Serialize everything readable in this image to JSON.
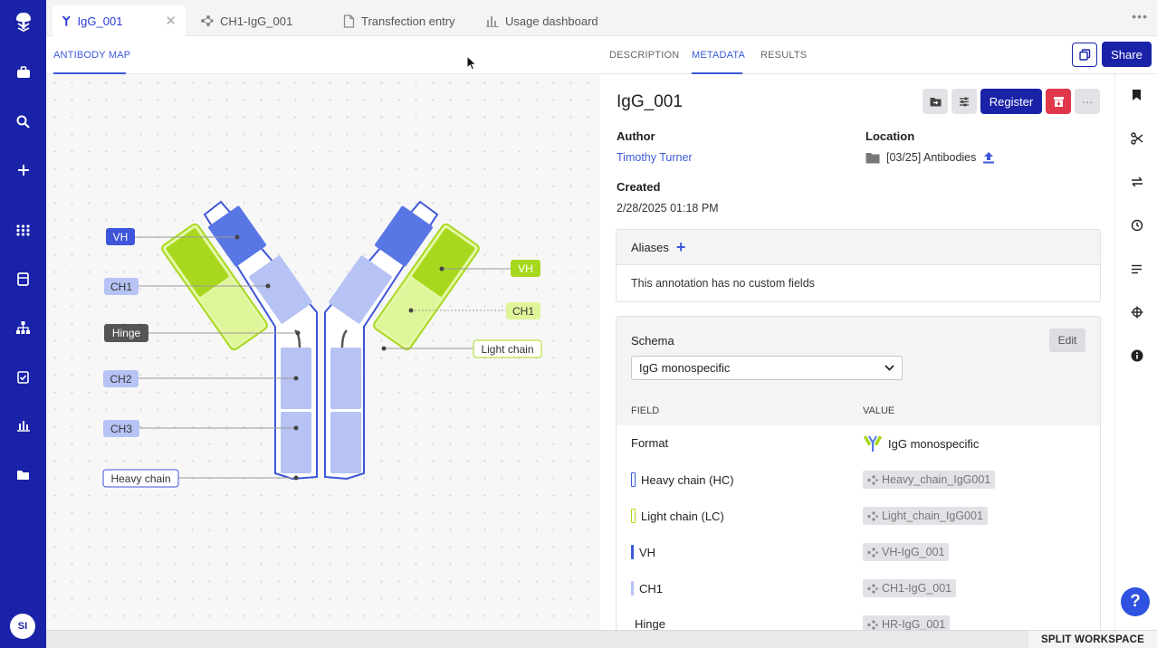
{
  "tabs": [
    {
      "label": "IgG_001",
      "icon": "antibody-icon",
      "active": true
    },
    {
      "label": "CH1-IgG_001",
      "icon": "molecule-icon"
    },
    {
      "label": "Transfection entry",
      "icon": "document-icon"
    },
    {
      "label": "Usage dashboard",
      "icon": "bar-chart-icon"
    }
  ],
  "tab_close": "✕",
  "tab_more": "•••",
  "map": {
    "subtab": "ANTIBODY MAP",
    "labels": {
      "vh_left": "VH",
      "ch1_left": "CH1",
      "hinge": "Hinge",
      "ch2": "CH2",
      "ch3": "CH3",
      "heavy_chain": "Heavy chain",
      "vh_right": "VH",
      "ch1_right": "CH1",
      "light_chain": "Light chain"
    }
  },
  "right_tabs": [
    "DESCRIPTION",
    "METADATA",
    "RESULTS"
  ],
  "share_label": "Share",
  "entity": {
    "title": "IgG_001",
    "register_label": "Register",
    "more": "···",
    "author_label": "Author",
    "author": "Timothy Turner",
    "location_label": "Location",
    "location": "[03/25] Antibodies",
    "created_label": "Created",
    "created": "2/28/2025 01:18 PM"
  },
  "aliases": {
    "label": "Aliases",
    "add": "+",
    "empty": "This annotation has no custom fields"
  },
  "schema": {
    "label": "Schema",
    "edit": "Edit",
    "selected": "IgG monospecific",
    "field_header": "FIELD",
    "value_header": "VALUE",
    "rows": [
      {
        "field": "Format",
        "value": "IgG monospecific"
      },
      {
        "field": "Heavy chain (HC)",
        "value": "Heavy_chain_IgG001"
      },
      {
        "field": "Light chain (LC)",
        "value": "Light_chain_IgG001"
      },
      {
        "field": "VH",
        "value": "VH-IgG_001"
      },
      {
        "field": "CH1",
        "value": "CH1-IgG_001"
      },
      {
        "field": "Hinge",
        "value": "HR-IgG_001"
      }
    ]
  },
  "user_initials": "SI",
  "help": "?",
  "split_workspace": "SPLIT WORKSPACE",
  "colors": {
    "nav": "#1a22a8",
    "accent": "#3c5ad8",
    "heavy_chain": "#5876e4",
    "heavy_light": "#b6c3f4",
    "light_chain": "#a8d81e",
    "light_light": "#dff59a",
    "archive": "#e0374a"
  }
}
